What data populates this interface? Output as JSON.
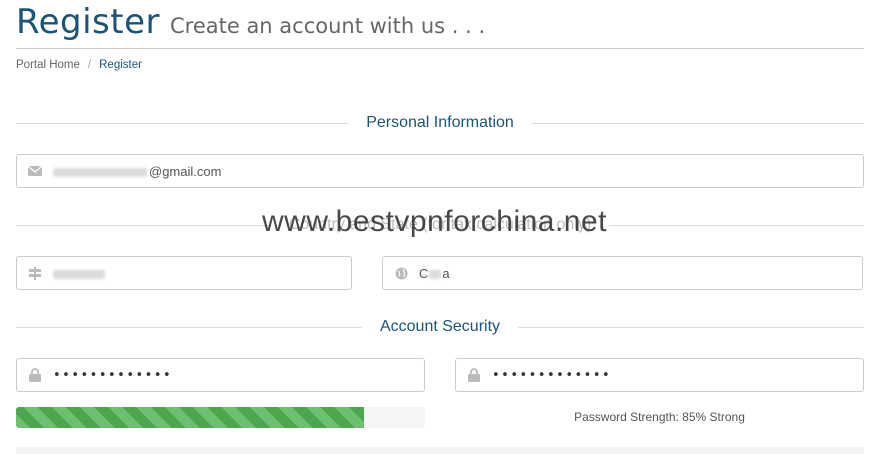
{
  "header": {
    "title": "Register",
    "subtitle": "Create an account with us . . ."
  },
  "breadcrumb": {
    "home": "Portal Home",
    "current": "Register",
    "separator": "/"
  },
  "sections": {
    "personal": "Personal Information",
    "tax": "Country and State (for tax calculation only)",
    "security": "Account Security"
  },
  "fields": {
    "email": {
      "value_suffix": "@gmail.com",
      "icon": "envelope-icon"
    },
    "state": {
      "value": "Zhejiang",
      "icon": "signpost-icon"
    },
    "country": {
      "value": "China",
      "icon": "globe-icon"
    },
    "password": {
      "mask": "•••••••••••••",
      "icon": "lock-icon"
    },
    "password_confirm": {
      "mask": "•••••••••••••",
      "icon": "lock-icon"
    }
  },
  "password_strength": {
    "label": "Password Strength: 85% Strong",
    "percent": 85
  },
  "watermark": "www.bestvpnforchina.net",
  "colors": {
    "accent": "#1a5477",
    "strength_bar": "#5cb85c"
  }
}
